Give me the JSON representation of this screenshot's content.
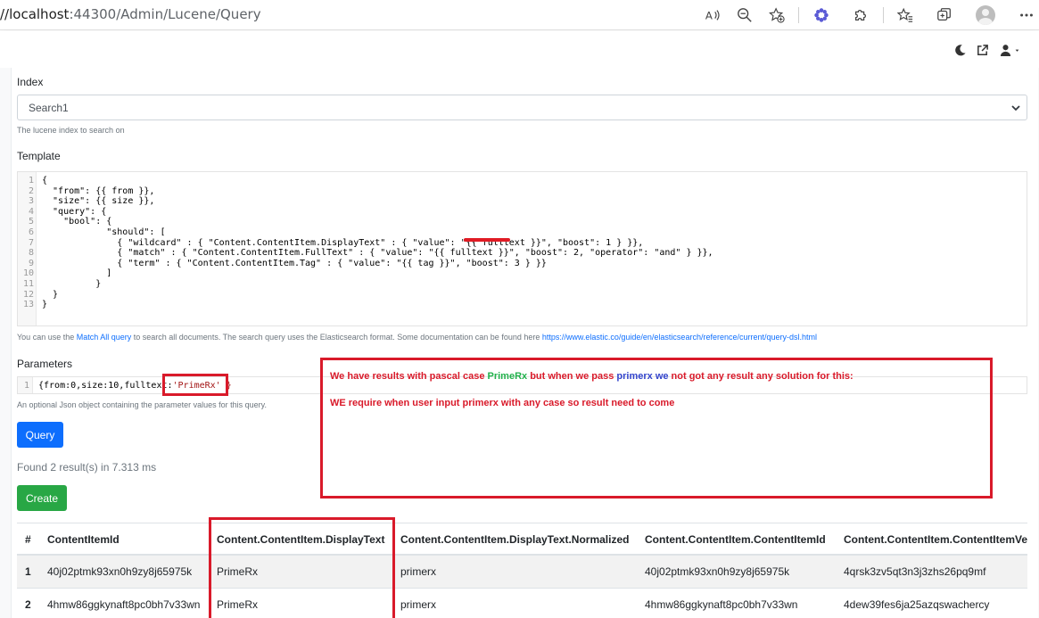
{
  "browser": {
    "url_host": "//localhost",
    "url_path": ":44300/Admin/Lucene/Query"
  },
  "form": {
    "index_label": "Index",
    "index_value": "Search1",
    "index_hint": "The lucene index to search on",
    "template_label": "Template",
    "template_lines": [
      {
        "n": "1",
        "text": "{"
      },
      {
        "n": "2",
        "text": "  \"from\": {{ from }},"
      },
      {
        "n": "3",
        "text": "  \"size\": {{ size }},"
      },
      {
        "n": "4",
        "text": "  \"query\": {"
      },
      {
        "n": "5",
        "text": "    \"bool\": {"
      },
      {
        "n": "6",
        "text": "            \"should\": ["
      },
      {
        "n": "7",
        "text": "              { \"wildcard\" : { \"Content.ContentItem.DisplayText\" : { \"value\": \"{{ fulltext }}\", \"boost\": 1 } }},"
      },
      {
        "n": "8",
        "text": "              { \"match\" : { \"Content.ContentItem.FullText\" : { \"value\": \"{{ fulltext }}\", \"boost\": 2, \"operator\": \"and\" } }},"
      },
      {
        "n": "9",
        "text": "              { \"term\" : { \"Content.ContentItem.Tag\" : { \"value\": \"{{ tag }}\", \"boost\": 3 } }}"
      },
      {
        "n": "10",
        "text": "            ]"
      },
      {
        "n": "11",
        "text": "          }"
      },
      {
        "n": "12",
        "text": "  }"
      },
      {
        "n": "13",
        "text": "}"
      }
    ],
    "template_hint_prefix": "You can use the ",
    "template_hint_link": "Match All query",
    "template_hint_mid": " to search all documents. The search query uses the Elasticsearch format. Some documentation can be found here ",
    "template_hint_url": "https://www.elastic.co/guide/en/elasticsearch/reference/current/query-dsl.html",
    "parameters_label": "Parameters",
    "param_line_no": "1",
    "param_text_a": "{from:0,size:10,fulltext:",
    "param_text_b": "'PrimeRx' }",
    "parameters_hint": "An optional Json object containing the parameter values for this query.",
    "query_button": "Query",
    "found_text": "Found 2 result(s) in 7.313 ms",
    "create_button": "Create"
  },
  "table": {
    "headers": [
      "#",
      "ContentItemId",
      "Content.ContentItem.DisplayText",
      "Content.ContentItem.DisplayText.Normalized",
      "Content.ContentItem.ContentItemId",
      "Content.ContentItem.ContentItemVe"
    ],
    "rows": [
      [
        "1",
        "40j02ptmk93xn0h9zy8j65975k",
        "PrimeRx",
        "primerx",
        "40j02ptmk93xn0h9zy8j65975k",
        "4qrsk3zv5qt3n3j3zhs26pq9mf"
      ],
      [
        "2",
        "4hmw86ggkynaft8pc0bh7v33wn",
        "PrimeRx",
        "primerx",
        "4hmw86ggkynaft8pc0bh7v33wn",
        "4dew39fes6ja25azqswachercy"
      ]
    ]
  },
  "annotation": {
    "line1_a": "We have results with pascal case ",
    "line1_green": "PrimeRx",
    "line1_b": " but when we pass ",
    "line1_blue1": "primerx",
    "line1_c": " ",
    "line1_blue2": "we",
    "line1_d": " not got any result any solution for this:",
    "line2": "WE require when user input primerx with any case so result need to come"
  },
  "colors": {
    "annotation_red": "#d91a2a",
    "primary_blue": "#0d6efd",
    "success_green": "#28a745"
  }
}
